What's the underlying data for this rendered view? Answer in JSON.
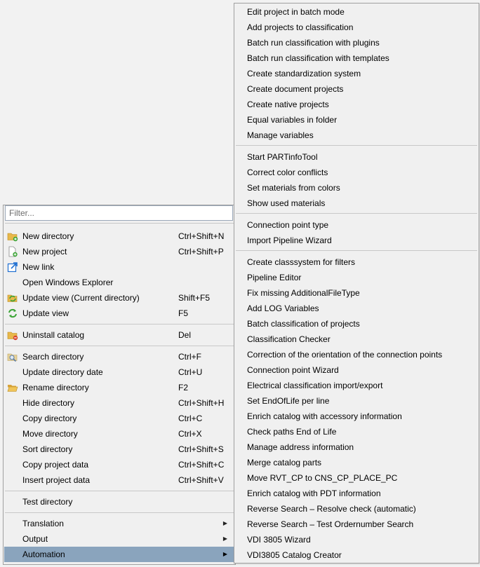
{
  "main_menu": {
    "filter_placeholder": "Filter...",
    "items": [
      {
        "label": "New directory",
        "shortcut": "Ctrl+Shift+N",
        "icon": "folder-new-icon"
      },
      {
        "label": "New project",
        "shortcut": "Ctrl+Shift+P",
        "icon": "document-new-icon"
      },
      {
        "label": "New link",
        "shortcut": "",
        "icon": "link-icon"
      },
      {
        "label": "Open Windows Explorer",
        "shortcut": "",
        "icon": ""
      },
      {
        "label": "Update view (Current directory)",
        "shortcut": "Shift+F5",
        "icon": "refresh-folder-icon"
      },
      {
        "label": "Update view",
        "shortcut": "F5",
        "icon": "refresh-icon"
      },
      {
        "label": "Uninstall catalog",
        "shortcut": "Del",
        "icon": "folder-delete-icon"
      },
      {
        "label": "Search directory",
        "shortcut": "Ctrl+F",
        "icon": "search-folder-icon"
      },
      {
        "label": "Update directory date",
        "shortcut": "Ctrl+U",
        "icon": ""
      },
      {
        "label": "Rename directory",
        "shortcut": "F2",
        "icon": "folder-open-icon"
      },
      {
        "label": "Hide directory",
        "shortcut": "Ctrl+Shift+H",
        "icon": ""
      },
      {
        "label": "Copy directory",
        "shortcut": "Ctrl+C",
        "icon": ""
      },
      {
        "label": "Move directory",
        "shortcut": "Ctrl+X",
        "icon": ""
      },
      {
        "label": "Sort directory",
        "shortcut": "Ctrl+Shift+S",
        "icon": ""
      },
      {
        "label": "Copy project data",
        "shortcut": "Ctrl+Shift+C",
        "icon": ""
      },
      {
        "label": "Insert project data",
        "shortcut": "Ctrl+Shift+V",
        "icon": ""
      },
      {
        "label": "Test directory",
        "shortcut": "",
        "icon": ""
      },
      {
        "label": "Translation",
        "shortcut": "",
        "icon": "",
        "submenu": true
      },
      {
        "label": "Output",
        "shortcut": "",
        "icon": "",
        "submenu": true
      },
      {
        "label": "Automation",
        "shortcut": "",
        "icon": "",
        "submenu": true,
        "selected": true
      }
    ]
  },
  "automation_menu": {
    "items": [
      "Edit project in batch mode",
      "Add projects to classification",
      "Batch run classification with plugins",
      "Batch run classification with templates",
      "Create standardization system",
      "Create document projects",
      "Create native projects",
      "Equal variables in folder",
      "Manage variables",
      "Start PARTinfoTool",
      "Correct color conflicts",
      "Set materials from colors",
      "Show used materials",
      "Connection point type",
      "Import Pipeline Wizard",
      "Create classsystem for filters",
      "Pipeline Editor",
      "Fix missing AdditionalFileType",
      "Add LOG Variables",
      "Batch classification of projects",
      "Classification Checker",
      "Correction of the orientation of the connection points",
      "Connection point Wizard",
      "Electrical classification import/export",
      "Set EndOfLife per line",
      "Enrich catalog with accessory information",
      "Check paths End of Life",
      "Manage address information",
      "Merge catalog parts",
      "Move RVT_CP to CNS_CP_PLACE_PC",
      "Enrich catalog with PDT information",
      "Reverse Search – Resolve check (automatic)",
      "Reverse Search – Test Ordernumber Search",
      "VDI 3805 Wizard",
      "VDI3805 Catalog Creator"
    ]
  },
  "colors": {
    "menu_bg": "#f0f0f0",
    "selected_bg": "#8aa4bd",
    "separator": "#c8c8c8",
    "folder_yellow": "#e8b84a",
    "green_badge": "#3aa335",
    "link_blue": "#1f6fd1",
    "delete_red": "#d9412b"
  }
}
